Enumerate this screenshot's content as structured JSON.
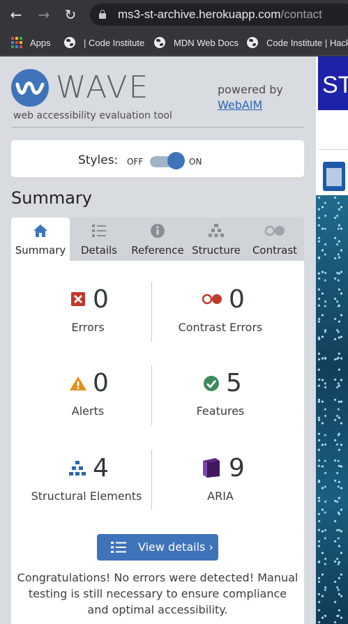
{
  "browser": {
    "url_domain": "ms3-st-archive.herokuapp.com",
    "url_path": "/contact",
    "bookmarks": [
      {
        "label": "Apps",
        "icon": "apps-grid-icon"
      },
      {
        "label": "| Code Institute",
        "icon": "globe-icon"
      },
      {
        "label": "MDN Web Docs",
        "icon": "globe-icon"
      },
      {
        "label": "Code Institute | Hackath",
        "icon": "globe-icon"
      }
    ]
  },
  "wave": {
    "logo_word": "WAVE",
    "tagline": "web accessibility evaluation tool",
    "powered_by": "powered by",
    "webaim_link": "WebAIM",
    "styles_label": "Styles:",
    "toggle_off": "OFF",
    "toggle_on": "ON",
    "toggle_state": "on",
    "summary_heading": "Summary",
    "tabs": [
      {
        "label": "Summary",
        "icon": "home-icon",
        "active": true
      },
      {
        "label": "Details",
        "icon": "list-icon",
        "active": false
      },
      {
        "label": "Reference",
        "icon": "info-icon",
        "active": false
      },
      {
        "label": "Structure",
        "icon": "hierarchy-icon",
        "active": false
      },
      {
        "label": "Contrast",
        "icon": "contrast-icon",
        "active": false
      }
    ],
    "stats": [
      {
        "label": "Errors",
        "count": "0",
        "icon": "error-icon"
      },
      {
        "label": "Contrast Errors",
        "count": "0",
        "icon": "contrast-error-icon"
      },
      {
        "label": "Alerts",
        "count": "0",
        "icon": "alert-icon"
      },
      {
        "label": "Features",
        "count": "5",
        "icon": "feature-check-icon"
      },
      {
        "label": "Structural Elements",
        "count": "4",
        "icon": "structure-icon"
      },
      {
        "label": "ARIA",
        "count": "9",
        "icon": "aria-icon"
      }
    ],
    "view_details": "View details ›",
    "congrats": "Congratulations! No errors were detected! Manual testing is still necessary to ensure compliance and optimal accessibility."
  },
  "page": {
    "heading_fragment": "ST"
  },
  "colors": {
    "accent": "#3f73ba",
    "error": "#c0392b",
    "alert": "#e3901c",
    "feature": "#3a8a5c",
    "aria": "#5a2a82"
  }
}
